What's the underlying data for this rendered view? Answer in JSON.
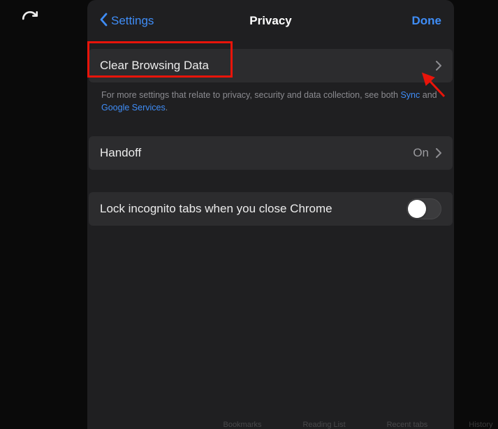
{
  "nav": {
    "back_label": "Settings",
    "title": "Privacy",
    "done_label": "Done"
  },
  "rows": {
    "clear_browsing": {
      "label": "Clear Browsing Data"
    },
    "handoff": {
      "label": "Handoff",
      "value": "On"
    },
    "lock_incognito": {
      "label": "Lock incognito tabs when you close Chrome"
    }
  },
  "footer": {
    "prefix": "For more settings that relate to privacy, security and data collection, see both ",
    "link1": "Sync",
    "mid": " and ",
    "link2": "Google Services",
    "suffix": "."
  },
  "bottom_tabs": {
    "a": "Bookmarks",
    "b": "Reading List",
    "c": "Recent tabs",
    "d": "History"
  }
}
